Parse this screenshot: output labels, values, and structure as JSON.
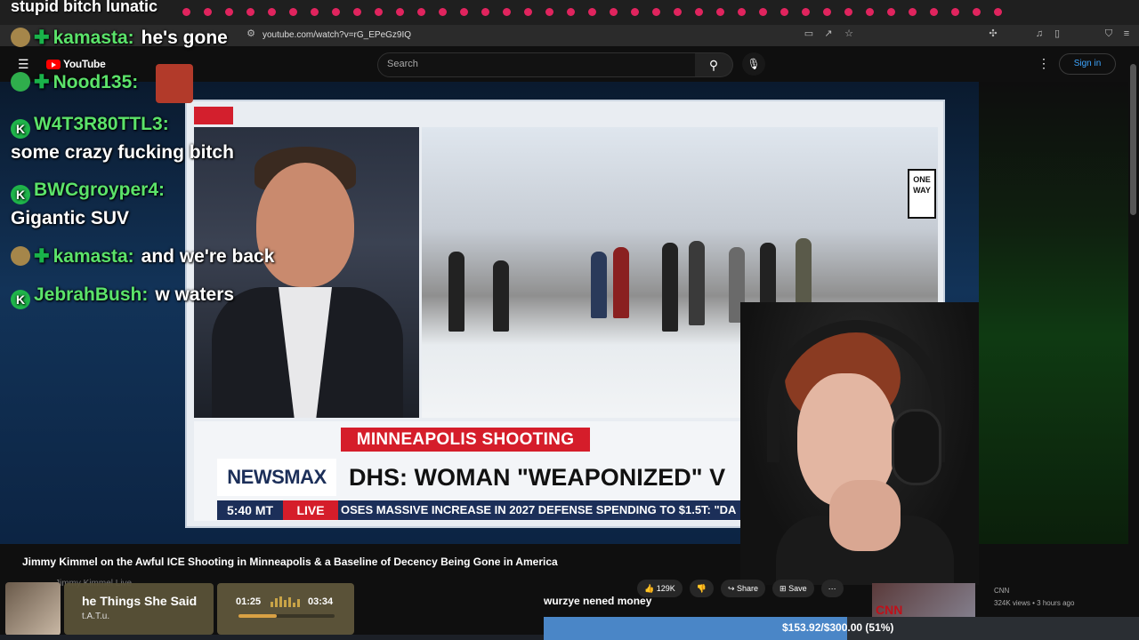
{
  "alert_text": "stupid bitch lunatic",
  "browser": {
    "url": "youtube.com/watch?v=rG_EPeGz9IQ"
  },
  "youtube": {
    "logo_text": "YouTube",
    "search_placeholder": "Search",
    "signin_label": "Sign in"
  },
  "chat": [
    {
      "user": "kamasta:",
      "message": "he's gone",
      "badge": "gold"
    },
    {
      "user": "Nood135:",
      "message": "",
      "badge": "heart"
    },
    {
      "user": "W4T3R80TTL3:",
      "message": "some crazy fucking bitch",
      "badge": "k"
    },
    {
      "user": "BWCgroyper4:",
      "message": "Gigantic SUV",
      "badge": "k"
    },
    {
      "user": "kamasta:",
      "message": "and we're back",
      "badge": "gold"
    },
    {
      "user": "JebrahBush:",
      "message": "w waters",
      "badge": "k"
    }
  ],
  "broadcast": {
    "breaking_label": "MINNEAPOLIS SHOOTING",
    "network": "NEWSMAX",
    "headline": "DHS: WOMAN \"WEAPONIZED\" V",
    "time": "5:40 MT",
    "live": "LIVE",
    "ticker": "OSES MASSIVE INCREASE IN 2027 DEFENSE SPENDING TO $1.5T: \"DA",
    "sign_text": "ONE WAY"
  },
  "video": {
    "title": "Jimmy Kimmel on the Awful ICE Shooting in Minneapolis & a Baseline of Decency Being Gone in America",
    "channel": "Jimmy Kimmel Live",
    "likes": "129K",
    "share_label": "Share",
    "save_label": "Save"
  },
  "caption": "wurzye nened money",
  "side_video": {
    "thumb_text": "CNN",
    "channel": "CNN",
    "meta": "324K views • 3 hours ago"
  },
  "music": {
    "title": "he Things She Said",
    "artist": "t.A.T.u.",
    "current_time": "01:25",
    "total_time": "03:34",
    "progress": 0.4
  },
  "goal": {
    "text": "$153.92/$300.00 (51%)",
    "fraction": 0.51
  }
}
